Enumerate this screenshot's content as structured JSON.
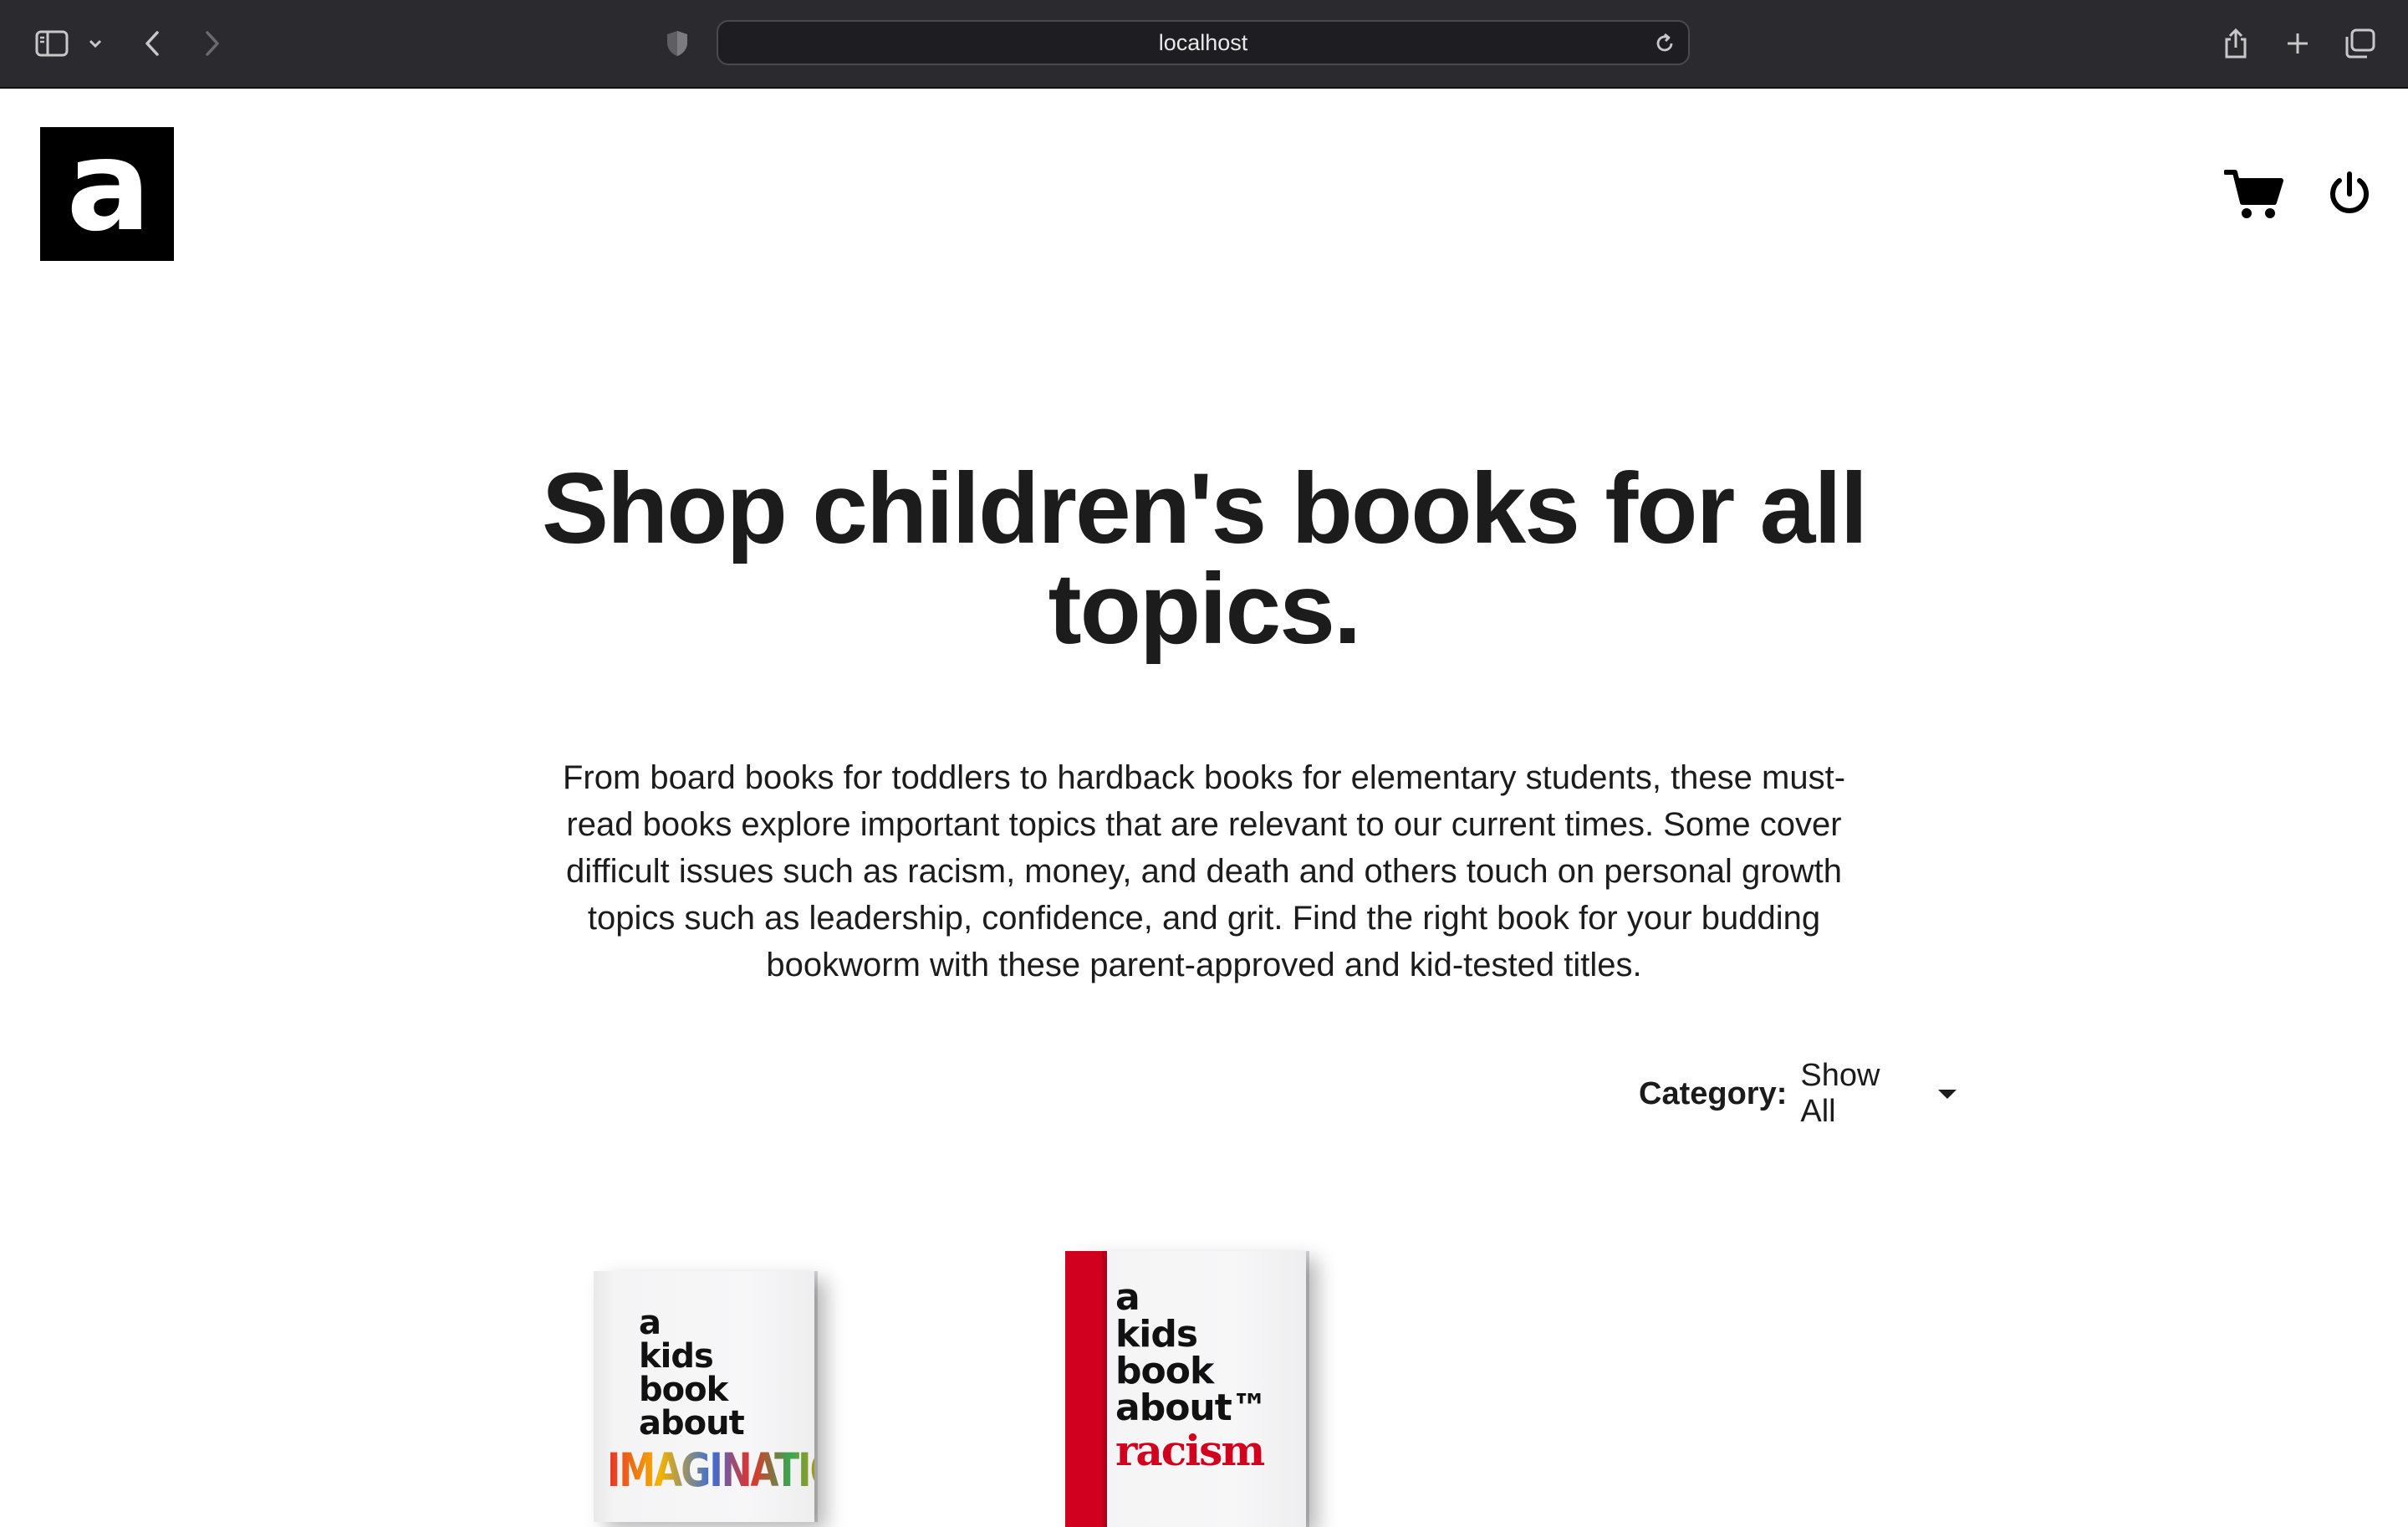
{
  "browser": {
    "url": "localhost"
  },
  "header": {
    "logo_letter": "a"
  },
  "hero": {
    "title": "Shop children's books for all topics.",
    "description": "From board books for toddlers to hardback books for elementary students, these must-read books explore important topics that are relevant to our current times. Some cover difficult issues such as racism, money, and death and others touch on personal growth topics such as leadership, confidence, and grit. Find the right book for your budding bookworm with these parent-approved and kid-tested titles."
  },
  "filter": {
    "label": "Category:",
    "value": "Show All"
  },
  "books": [
    {
      "line1": "a",
      "line2": "kids",
      "line3": "book",
      "line4": "about",
      "topic": "IMAGINATION"
    },
    {
      "line1": "a",
      "line2": "kids",
      "line3": "book",
      "line4": "about™",
      "topic": "racism",
      "spine_color": "#d2001f"
    }
  ]
}
